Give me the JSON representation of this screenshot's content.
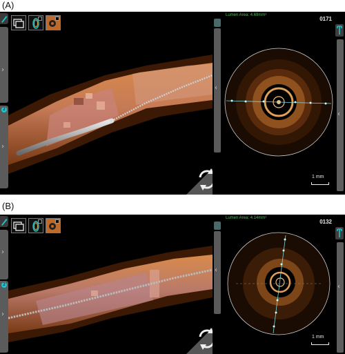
{
  "panels": [
    {
      "label": "(A)",
      "lumen_area": "Lumen Area: 4.69mm²",
      "frame_number": "0171",
      "scale_label": "1 mm"
    },
    {
      "label": "(B)",
      "lumen_area": "Lumen Area: 4.14mm²",
      "frame_number": "0132",
      "scale_label": "1 mm"
    }
  ],
  "icons": {
    "pen": "pen-icon",
    "views": [
      "longitudinal-view-icon",
      "ring-view-icon",
      "cross-section-view-icon"
    ],
    "rotate": "rotate-view-icon",
    "wrench": "wrench-icon"
  },
  "colors": {
    "accent": "#24c1c9",
    "lumen_text": "#4fbf5a",
    "vessel": "#b96a3c",
    "background": "#000000"
  }
}
